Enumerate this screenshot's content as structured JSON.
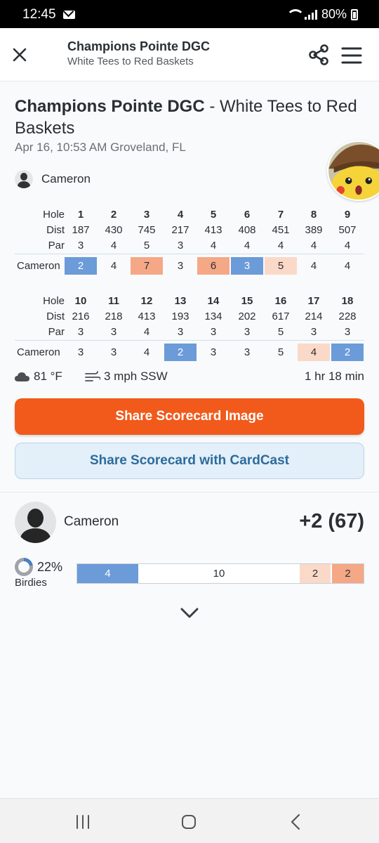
{
  "status_bar": {
    "time": "12:45",
    "battery": "80%"
  },
  "app_bar": {
    "title": "Champions Pointe DGC",
    "subtitle": "White Tees to Red Baskets"
  },
  "round": {
    "course": "Champions Pointe DGC",
    "layout_suffix": " - White Tees to Red Baskets",
    "meta": "Apr 16, 10:53 AM Groveland, FL",
    "player": "Cameron"
  },
  "scorecard": {
    "labels": {
      "hole": "Hole",
      "dist": "Dist",
      "par": "Par"
    },
    "front": {
      "holes": [
        "1",
        "2",
        "3",
        "4",
        "5",
        "6",
        "7",
        "8",
        "9"
      ],
      "dist": [
        "187",
        "430",
        "745",
        "217",
        "413",
        "408",
        "451",
        "389",
        "507"
      ],
      "par": [
        "3",
        "4",
        "5",
        "3",
        "4",
        "4",
        "4",
        "4",
        "4"
      ],
      "player": "Cameron",
      "scores": [
        "2",
        "4",
        "7",
        "3",
        "6",
        "3",
        "5",
        "4",
        "4"
      ],
      "score_types": [
        "birdie",
        "par",
        "double",
        "par",
        "double",
        "birdie",
        "bogey",
        "par",
        "par"
      ]
    },
    "back": {
      "holes": [
        "10",
        "11",
        "12",
        "13",
        "14",
        "15",
        "16",
        "17",
        "18"
      ],
      "dist": [
        "216",
        "218",
        "413",
        "193",
        "134",
        "202",
        "617",
        "214",
        "228"
      ],
      "par": [
        "3",
        "3",
        "4",
        "3",
        "3",
        "3",
        "5",
        "3",
        "3"
      ],
      "player": "Cameron",
      "scores": [
        "3",
        "3",
        "4",
        "2",
        "3",
        "3",
        "5",
        "4",
        "2"
      ],
      "score_types": [
        "par",
        "par",
        "par",
        "birdie",
        "par",
        "par",
        "par",
        "bogey",
        "birdie"
      ]
    }
  },
  "weather": {
    "temp": "81 °F",
    "wind": "3 mph SSW",
    "duration": "1 hr 18 min"
  },
  "buttons": {
    "share_image": "Share Scorecard Image",
    "share_cardcast": "Share Scorecard with CardCast"
  },
  "summary": {
    "player": "Cameron",
    "score": "+2 (67)",
    "birdie_pct_value": 22,
    "birdie_pct": "22%",
    "birdie_label": "Birdies",
    "distribution": [
      {
        "type": "birdie",
        "count": "4",
        "color": "#6b9bd8"
      },
      {
        "type": "par",
        "count": "10",
        "color": "#ffffff"
      },
      {
        "type": "bogey",
        "count": "2",
        "color": "#fbd9c8"
      },
      {
        "type": "double",
        "count": "2",
        "color": "#f4a886"
      }
    ]
  },
  "colors": {
    "primary": "#f15a1b",
    "birdie": "#6b9bd8",
    "bogey": "#fbd9c8",
    "double": "#f4a886",
    "cardcast_text": "#2d6b9b"
  }
}
